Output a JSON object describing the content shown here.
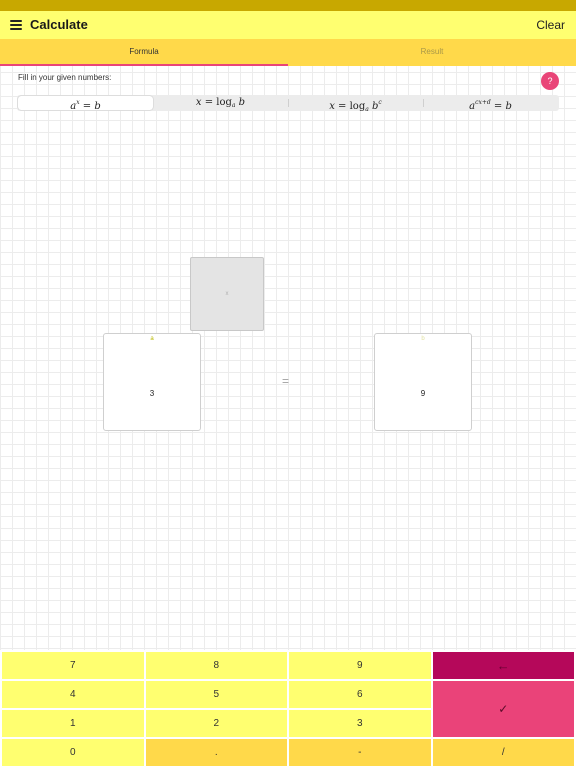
{
  "header": {
    "title": "Calculate",
    "clear_label": "Clear"
  },
  "tabs": [
    {
      "label": "Formula",
      "active": true
    },
    {
      "label": "Result",
      "active": false
    }
  ],
  "instruction": "Fill in your given numbers:",
  "help_label": "?",
  "formulas": {
    "selected_index": 0,
    "options": [
      "a^x = b",
      "x = log_a b",
      "x = log_a b^c",
      "a^(cx+d) = b"
    ]
  },
  "boxes": {
    "exponent": {
      "tag": "x"
    },
    "base": {
      "tag": "a",
      "value": "3"
    },
    "result": {
      "tag": "b",
      "value": "9"
    },
    "equals": "="
  },
  "keypad": {
    "keys": [
      "7",
      "8",
      "9",
      "4",
      "5",
      "6",
      "1",
      "2",
      "3",
      "0",
      ".",
      "-",
      "/"
    ],
    "backspace_icon": "backspace-arrow-icon",
    "done_icon": "checkmark-icon"
  },
  "colors": {
    "header_bg": "#ffff70",
    "tab_bg": "#ffd94a",
    "accent_pink": "#e94578",
    "backspace_key": "#b5085a",
    "status_strip": "#c8a800"
  }
}
